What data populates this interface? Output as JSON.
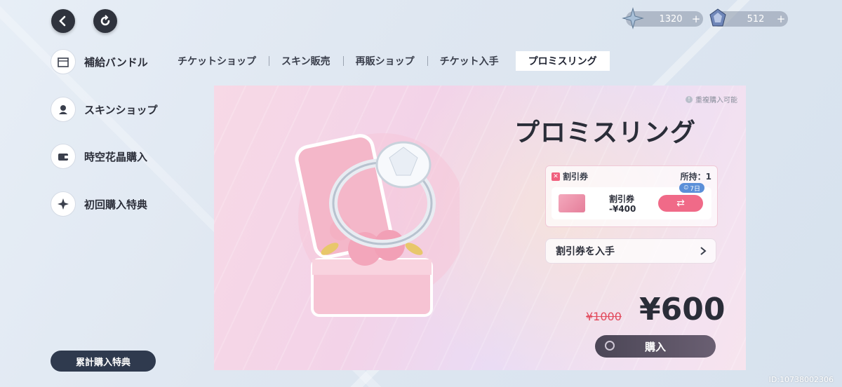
{
  "top": {
    "back_icon": "chevron-left-icon",
    "refresh_icon": "refresh-icon"
  },
  "currency": [
    {
      "icon": "star-crystal-icon",
      "value": "1320",
      "plus": "+"
    },
    {
      "icon": "blue-crystal-icon",
      "value": "512",
      "plus": "+"
    }
  ],
  "sidebar": {
    "items": [
      {
        "label": "補給バンドル",
        "icon": "calendar-icon"
      },
      {
        "label": "スキンショップ",
        "icon": "skin-icon"
      },
      {
        "label": "時空花晶購入",
        "icon": "wallet-icon"
      },
      {
        "label": "初回購入特典",
        "icon": "compass-icon"
      }
    ],
    "bottom_button": "累計購入特典"
  },
  "tabs": [
    {
      "label": "チケットショップ",
      "active": false
    },
    {
      "label": "スキン販売",
      "active": false
    },
    {
      "label": "再販ショップ",
      "active": false
    },
    {
      "label": "チケット入手",
      "active": false
    },
    {
      "label": "プロミスリング",
      "active": true
    }
  ],
  "product": {
    "title": "プロミスリング",
    "duplicate_note": "重複購入可能",
    "coupon": {
      "label": "割引券",
      "owned": "所持：1",
      "days": "7日",
      "name": "割引券",
      "value": "-¥400",
      "swap_icon": "swap-icon"
    },
    "get_coupon": "割引券を入手",
    "old_price": "¥1000",
    "price": "¥600",
    "buy": "購入"
  },
  "footer": {
    "id": "ID:10738002306"
  },
  "colors": {
    "accent_pink": "#f06a88",
    "dark_button": "#2f333d",
    "strike_red": "#e24a5c"
  }
}
